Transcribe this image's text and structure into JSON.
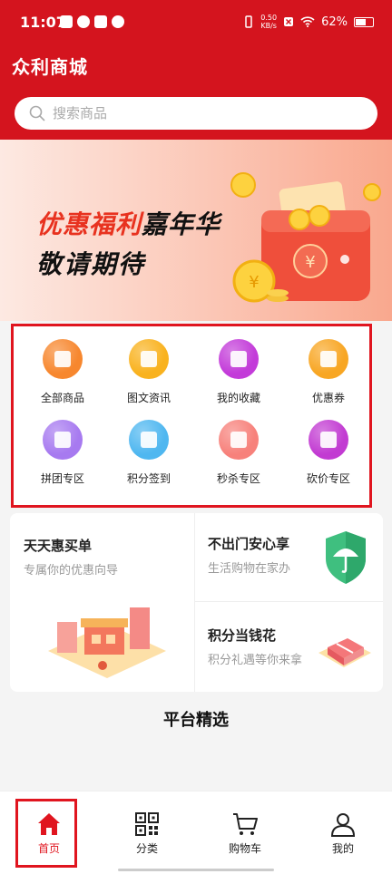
{
  "status_bar": {
    "time": "11:07",
    "net_speed_value": "0.50",
    "net_speed_unit": "KB/s",
    "battery": "62%",
    "battery_level": 0.62
  },
  "header": {
    "title": "众利商城",
    "search_placeholder": "搜索商品"
  },
  "banner": {
    "line1_red": "优惠福利",
    "line1_black": "嘉年华",
    "line2": "敬请期待"
  },
  "categories": [
    {
      "label": "全部商品",
      "color": "#f7872e",
      "icon": "store-icon"
    },
    {
      "label": "图文资讯",
      "color": "#f9b21e",
      "icon": "document-icon"
    },
    {
      "label": "我的收藏",
      "color": "#c33bd9",
      "icon": "bookmark-icon"
    },
    {
      "label": "优惠券",
      "color": "#f8a623",
      "icon": "coupon-icon"
    },
    {
      "label": "拼团专区",
      "color": "#a77af0",
      "icon": "shopping-bag-icon"
    },
    {
      "label": "积分签到",
      "color": "#4fb7f0",
      "icon": "calendar-check-icon"
    },
    {
      "label": "秒杀专区",
      "color": "#f7817b",
      "icon": "alarm-clock-icon"
    },
    {
      "label": "砍价专区",
      "color": "#c23bd2",
      "icon": "discount-tag-icon"
    }
  ],
  "promo": {
    "left_title": "天天惠买单",
    "left_subtitle": "专属你的优惠向导",
    "right_top_title": "不出门安心享",
    "right_top_subtitle": "生活购物在家办",
    "right_bottom_title": "积分当钱花",
    "right_bottom_subtitle": "积分礼遇等你来拿"
  },
  "section": {
    "title": "平台精选"
  },
  "tabs": [
    {
      "label": "首页",
      "icon": "home-icon",
      "active": true
    },
    {
      "label": "分类",
      "icon": "qr-code-icon",
      "active": false
    },
    {
      "label": "购物车",
      "icon": "cart-icon",
      "active": false
    },
    {
      "label": "我的",
      "icon": "user-icon",
      "active": false
    }
  ],
  "colors": {
    "brand_red": "#d4141e",
    "highlight_border": "#e0151f"
  }
}
